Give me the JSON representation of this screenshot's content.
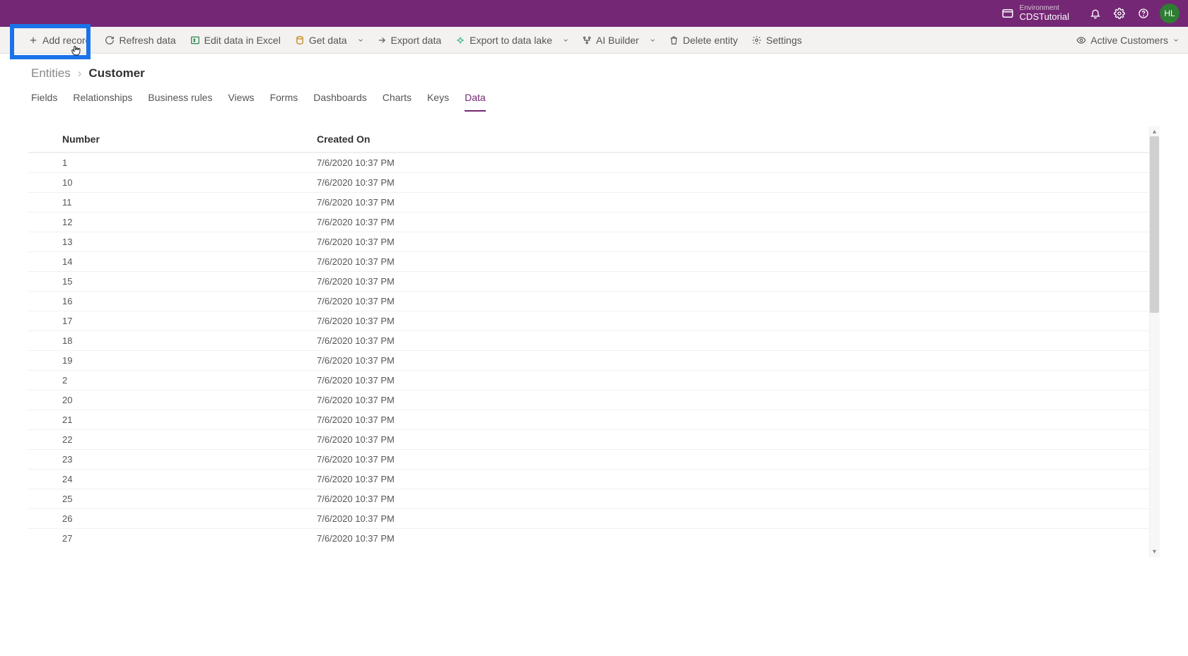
{
  "header": {
    "environment_label": "Environment",
    "environment_name": "CDSTutorial",
    "avatar_initials": "HL"
  },
  "commands": {
    "add_record": "Add record",
    "refresh_data": "Refresh data",
    "edit_in_excel": "Edit data in Excel",
    "get_data": "Get data",
    "export_data": "Export data",
    "export_datalake": "Export to data lake",
    "ai_builder": "AI Builder",
    "delete_entity": "Delete entity",
    "settings": "Settings",
    "view_selector": "Active Customers"
  },
  "breadcrumb": {
    "parent": "Entities",
    "current": "Customer"
  },
  "tabs": [
    "Fields",
    "Relationships",
    "Business rules",
    "Views",
    "Forms",
    "Dashboards",
    "Charts",
    "Keys",
    "Data"
  ],
  "active_tab": "Data",
  "columns": {
    "number": "Number",
    "created": "Created On"
  },
  "rows": [
    {
      "number": "1",
      "created": "7/6/2020 10:37 PM"
    },
    {
      "number": "10",
      "created": "7/6/2020 10:37 PM"
    },
    {
      "number": "11",
      "created": "7/6/2020 10:37 PM"
    },
    {
      "number": "12",
      "created": "7/6/2020 10:37 PM"
    },
    {
      "number": "13",
      "created": "7/6/2020 10:37 PM"
    },
    {
      "number": "14",
      "created": "7/6/2020 10:37 PM"
    },
    {
      "number": "15",
      "created": "7/6/2020 10:37 PM"
    },
    {
      "number": "16",
      "created": "7/6/2020 10:37 PM"
    },
    {
      "number": "17",
      "created": "7/6/2020 10:37 PM"
    },
    {
      "number": "18",
      "created": "7/6/2020 10:37 PM"
    },
    {
      "number": "19",
      "created": "7/6/2020 10:37 PM"
    },
    {
      "number": "2",
      "created": "7/6/2020 10:37 PM"
    },
    {
      "number": "20",
      "created": "7/6/2020 10:37 PM"
    },
    {
      "number": "21",
      "created": "7/6/2020 10:37 PM"
    },
    {
      "number": "22",
      "created": "7/6/2020 10:37 PM"
    },
    {
      "number": "23",
      "created": "7/6/2020 10:37 PM"
    },
    {
      "number": "24",
      "created": "7/6/2020 10:37 PM"
    },
    {
      "number": "25",
      "created": "7/6/2020 10:37 PM"
    },
    {
      "number": "26",
      "created": "7/6/2020 10:37 PM"
    },
    {
      "number": "27",
      "created": "7/6/2020 10:37 PM"
    }
  ]
}
